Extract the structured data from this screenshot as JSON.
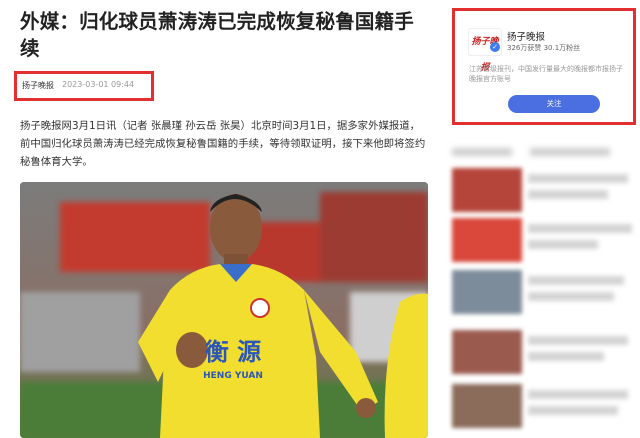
{
  "article": {
    "title": "外媒：归化球员萧涛涛已完成恢复秘鲁国籍手续",
    "source": "扬子晚报",
    "time": "2023-03-01 09:44",
    "paragraph": "扬子晚报网3月1日讯（记者 张晨瑾 孙云岳 张昊）北京时间3月1日，据多家外媒报道，前中国归化球员萧涛涛已经完成恢复秘鲁国籍的手续，等待领取证明，接下来他即将签约秘鲁体育大学。",
    "photo": {
      "jersey_text": "衡 源",
      "jersey_sub": "HENG   YUAN"
    }
  },
  "profile": {
    "logo_text": "扬子晚报",
    "name": "扬子晚报",
    "stats": "326万获赞  30.1万粉丝",
    "description": "江苏省级报刊，中国发行量最大的晚报都市报扬子晚报官方账号",
    "follow_label": "关注",
    "verify_mark": "✓"
  },
  "colors": {
    "highlight_border": "#e23030",
    "follow_button": "#4b6fe0",
    "jersey_yellow": "#f2de2e"
  }
}
